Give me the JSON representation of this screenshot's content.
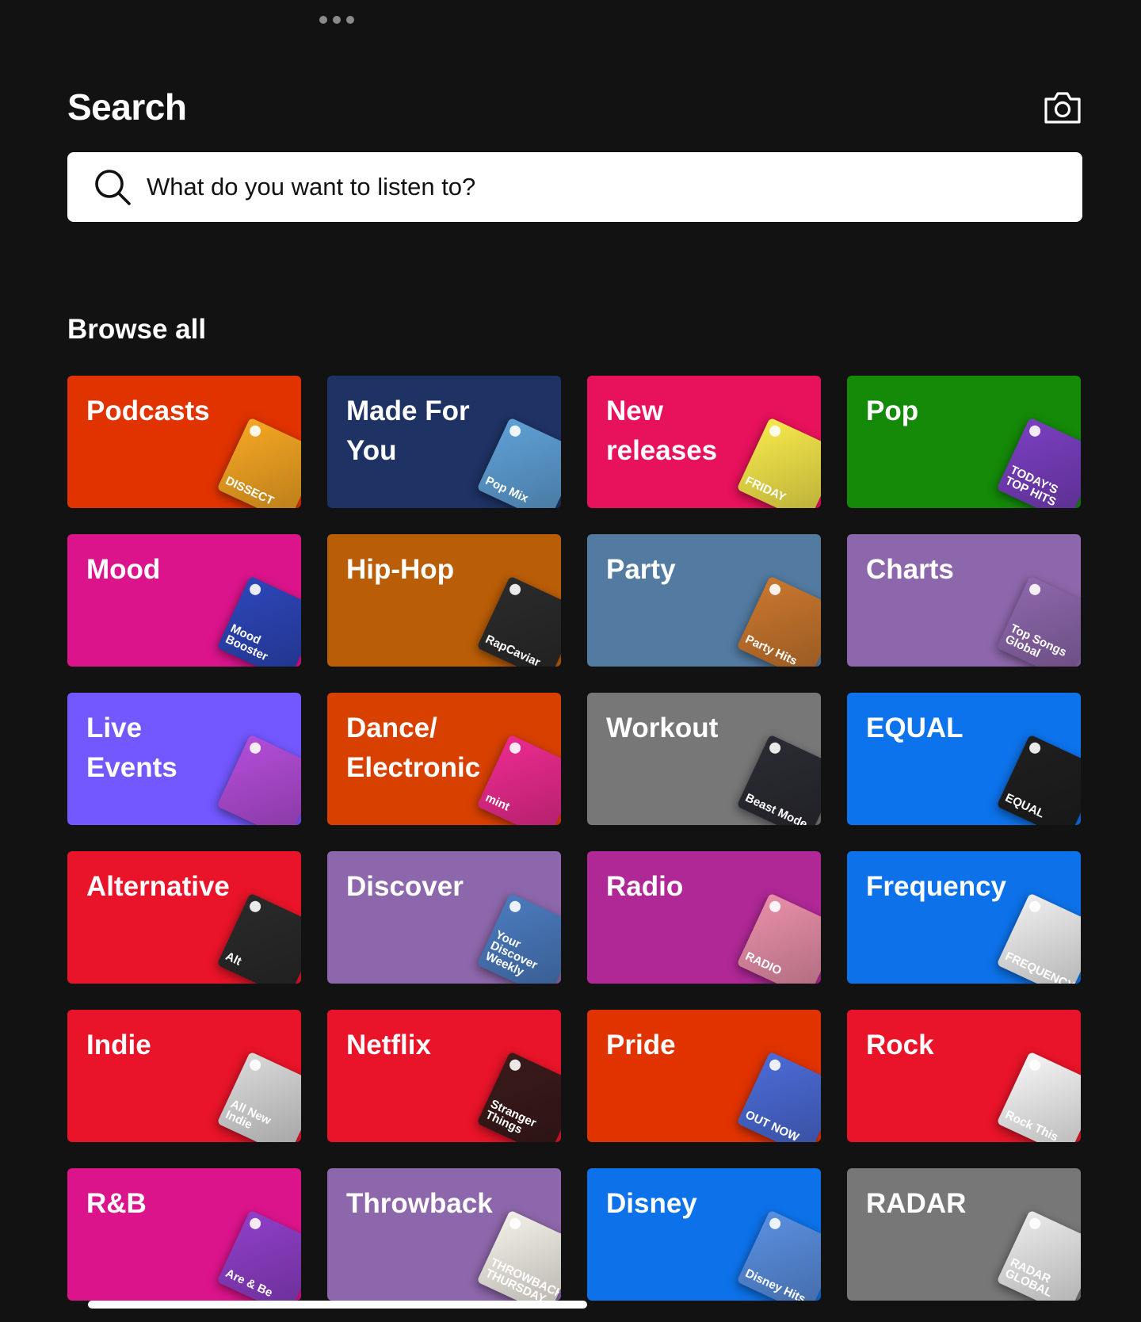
{
  "header": {
    "title": "Search"
  },
  "search": {
    "placeholder": "What do you want to listen to?"
  },
  "browse": {
    "heading": "Browse all",
    "tiles": [
      {
        "label": "Podcasts",
        "color": "#e13300",
        "cover_color": "#f5a623",
        "cover_text": "DISSECT"
      },
      {
        "label": "Made For You",
        "color": "#1e3264",
        "cover_color": "#5fa0d6",
        "cover_text": "Pop Mix"
      },
      {
        "label": "New releases",
        "color": "#e8115b",
        "cover_color": "#f6e84b",
        "cover_text": "FRIDAY"
      },
      {
        "label": "Pop",
        "color": "#148a08",
        "cover_color": "#7a3fc0",
        "cover_text": "TODAY'S TOP HITS"
      },
      {
        "label": "Mood",
        "color": "#dc148c",
        "cover_color": "#2d46b9",
        "cover_text": "Mood Booster"
      },
      {
        "label": "Hip-Hop",
        "color": "#ba5d07",
        "cover_color": "#2b2b2b",
        "cover_text": "RapCaviar"
      },
      {
        "label": "Party",
        "color": "#537aa1",
        "cover_color": "#c9772e",
        "cover_text": "Party Hits"
      },
      {
        "label": "Charts",
        "color": "#8d67ab",
        "cover_color": "#8d67ab",
        "cover_text": "Top Songs Global"
      },
      {
        "label": "Live Events",
        "color": "#7358ff",
        "cover_color": "#b44dd9",
        "cover_text": ""
      },
      {
        "label": "Dance/ Electronic",
        "color": "#d84000",
        "cover_color": "#ec2b8f",
        "cover_text": "mint"
      },
      {
        "label": "Workout",
        "color": "#777777",
        "cover_color": "#2b2b33",
        "cover_text": "Beast Mode"
      },
      {
        "label": "EQUAL",
        "color": "#0d73ec",
        "cover_color": "#1f1f1f",
        "cover_text": "EQUAL"
      },
      {
        "label": "Alternative",
        "color": "#e91429",
        "cover_color": "#2a2a2a",
        "cover_text": "Alt"
      },
      {
        "label": "Discover",
        "color": "#8d67ab",
        "cover_color": "#4b7bbf",
        "cover_text": "Your Discover Weekly"
      },
      {
        "label": "Radio",
        "color": "#af2896",
        "cover_color": "#e88fa8",
        "cover_text": "RADIO"
      },
      {
        "label": "Frequency",
        "color": "#0d72ea",
        "cover_color": "#eeeeee",
        "cover_text": "FREQUENCY"
      },
      {
        "label": "Indie",
        "color": "#e91429",
        "cover_color": "#d9d9d9",
        "cover_text": "All New Indie"
      },
      {
        "label": "Netflix",
        "color": "#e91429",
        "cover_color": "#3a1a1a",
        "cover_text": "Stranger Things"
      },
      {
        "label": "Pride",
        "color": "#e13300",
        "cover_color": "#4b6bd6",
        "cover_text": "OUT NOW"
      },
      {
        "label": "Rock",
        "color": "#e91429",
        "cover_color": "#f5f5f5",
        "cover_text": "Rock This"
      },
      {
        "label": "R&B",
        "color": "#dc148c",
        "cover_color": "#8f3fc8",
        "cover_text": "Are & Be"
      },
      {
        "label": "Throwback",
        "color": "#8d67ab",
        "cover_color": "#f3f0e7",
        "cover_text": "THROWBACK THURSDAY"
      },
      {
        "label": "Disney",
        "color": "#0d72ea",
        "cover_color": "#5a8fe0",
        "cover_text": "Disney Hits"
      },
      {
        "label": "RADAR",
        "color": "#777777",
        "cover_color": "#eaeaea",
        "cover_text": "RADAR GLOBAL"
      }
    ]
  }
}
